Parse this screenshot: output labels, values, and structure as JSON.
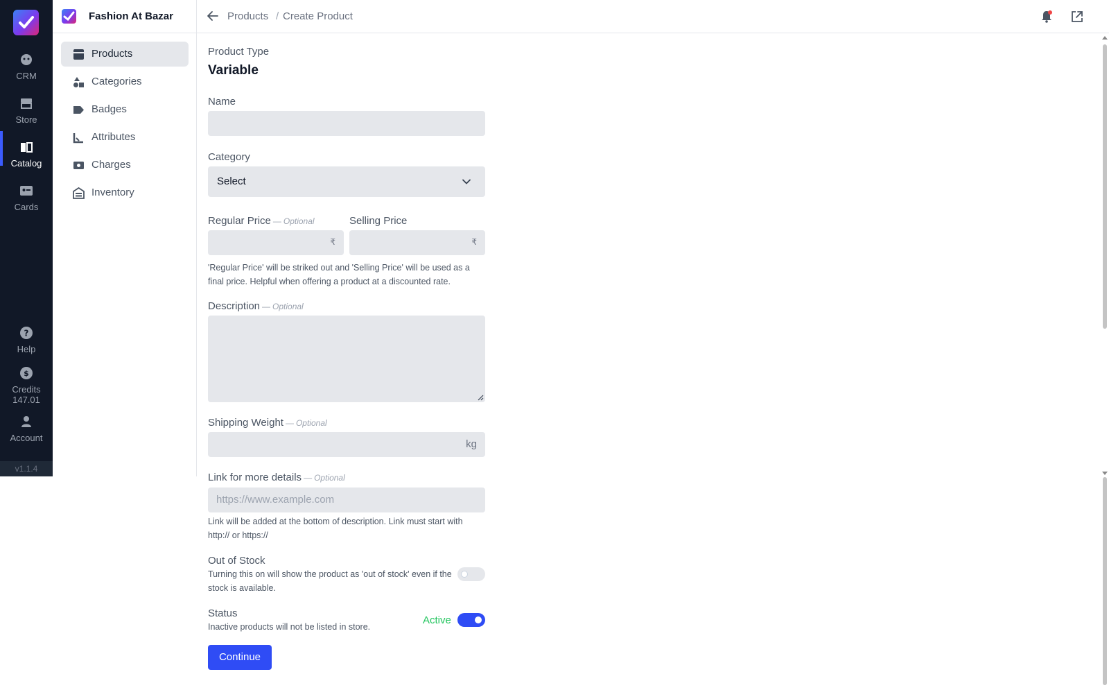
{
  "rail": {
    "items": [
      {
        "label": "CRM"
      },
      {
        "label": "Store"
      },
      {
        "label": "Catalog"
      },
      {
        "label": "Cards"
      },
      {
        "label": "Help"
      },
      {
        "label": "Credits",
        "value": "147.01"
      },
      {
        "label": "Account"
      }
    ],
    "version": "v1.1.4"
  },
  "sidebar": {
    "title": "Fashion At Bazar",
    "items": [
      {
        "label": "Products",
        "icon": "box-icon"
      },
      {
        "label": "Categories",
        "icon": "shapes-icon"
      },
      {
        "label": "Badges",
        "icon": "tag-icon"
      },
      {
        "label": "Attributes",
        "icon": "ruler-icon"
      },
      {
        "label": "Charges",
        "icon": "banknote-icon"
      },
      {
        "label": "Inventory",
        "icon": "warehouse-icon"
      }
    ]
  },
  "header": {
    "breadcrumb": [
      "Products",
      "Create Product"
    ],
    "separator": "/"
  },
  "form": {
    "product_type_label": "Product Type",
    "product_type_value": "Variable",
    "name_label": "Name",
    "category_label": "Category",
    "category_value": "Select",
    "regular_price_label": "Regular Price",
    "optional": "Optional",
    "dash": "—",
    "selling_price_label": "Selling Price",
    "currency": "₹",
    "price_help": "'Regular Price' will be striked out and 'Selling Price' will be used as a final price. Helpful when offering a product at a discounted rate.",
    "description_label": "Description",
    "shipping_weight_label": "Shipping Weight",
    "weight_unit": "kg",
    "link_label": "Link for more details",
    "link_placeholder": "https://www.example.com",
    "link_help": "Link will be added at the bottom of description. Link must start with http:// or https://",
    "out_of_stock_label": "Out of Stock",
    "out_of_stock_help": "Turning this on will show the product as 'out of stock' even if the stock is available.",
    "out_of_stock_on": false,
    "status_label": "Status",
    "status_help": "Inactive products will not be listed in store.",
    "status_value": "Active",
    "status_on": true,
    "continue_label": "Continue"
  },
  "colors": {
    "accent": "#2f4cf5",
    "active_green": "#22c55e",
    "rail_bg": "#111827"
  }
}
